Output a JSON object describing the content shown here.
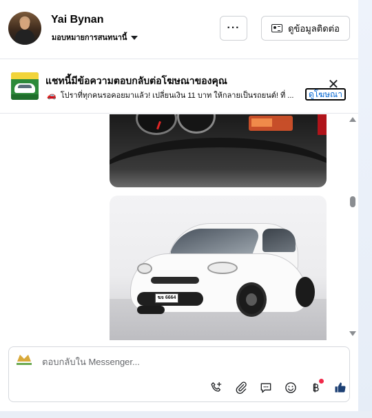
{
  "header": {
    "contact_name": "Yai Bynan",
    "contact_subtitle": "มอบหมายการสนทนานี้",
    "more_label": "···",
    "contact_info_label": "ดูข้อมูลติดต่อ"
  },
  "ad_banner": {
    "title": "แชทนี้มีข้อความตอบกลับต่อโฆษณาของคุณ",
    "text": "โปราที่ทุกคนรอคอยมาแล้ว! เปลี่ยนเงิน 11 บาท ให้กลายเป็นรถยนต์! ที่ ...",
    "emoji": "🚗",
    "view_ad_label": "ดูโฆษณา",
    "close_label": "✕"
  },
  "messages": {
    "image_1": "dashboard-photo",
    "image_2": "white-car-photo",
    "plate_text": "ฆจ 6664"
  },
  "composer": {
    "placeholder": "ตอบกลับใน Messenger...",
    "tools": [
      "phone-plus-icon",
      "paperclip-icon",
      "saved-reply-icon",
      "emoji-icon",
      "baht-icon",
      "thumbs-up-icon"
    ]
  },
  "colors": {
    "accent": "#0064d1",
    "badge": "#f02849",
    "border": "#d5d8dd"
  }
}
